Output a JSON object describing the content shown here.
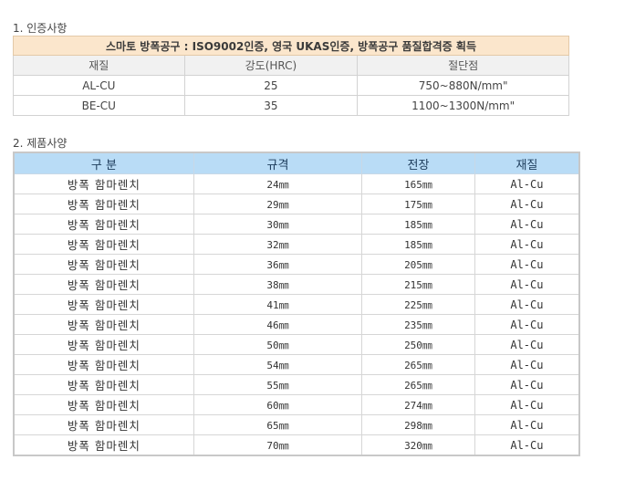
{
  "section1": {
    "title": "1. 인증사항",
    "banner": "스마토 방폭공구 : ISO9002인증, 영국 UKAS인증, 방폭공구 품질합격증 획득",
    "headers": [
      "재질",
      "강도(HRC)",
      "절단점"
    ],
    "rows": [
      [
        "AL-CU",
        "25",
        "750~880N/mm\""
      ],
      [
        "BE-CU",
        "35",
        "1100~1300N/mm\""
      ]
    ]
  },
  "section2": {
    "title": "2. 제품사양",
    "headers": [
      "구  분",
      "규격",
      "전장",
      "재질"
    ],
    "rows": [
      [
        "방폭 함마렌치",
        "24㎜",
        "165㎜",
        "Al-Cu"
      ],
      [
        "방폭 함마렌치",
        "29㎜",
        "175㎜",
        "Al-Cu"
      ],
      [
        "방폭 함마렌치",
        "30㎜",
        "185㎜",
        "Al-Cu"
      ],
      [
        "방폭 함마렌치",
        "32㎜",
        "185㎜",
        "Al-Cu"
      ],
      [
        "방폭 함마렌치",
        "36㎜",
        "205㎜",
        "Al-Cu"
      ],
      [
        "방폭 함마렌치",
        "38㎜",
        "215㎜",
        "Al-Cu"
      ],
      [
        "방폭 함마렌치",
        "41㎜",
        "225㎜",
        "Al-Cu"
      ],
      [
        "방폭 함마렌치",
        "46㎜",
        "235㎜",
        "Al-Cu"
      ],
      [
        "방폭 함마렌치",
        "50㎜",
        "250㎜",
        "Al-Cu"
      ],
      [
        "방폭 함마렌치",
        "54㎜",
        "265㎜",
        "Al-Cu"
      ],
      [
        "방폭 함마렌치",
        "55㎜",
        "265㎜",
        "Al-Cu"
      ],
      [
        "방폭 함마렌치",
        "60㎜",
        "274㎜",
        "Al-Cu"
      ],
      [
        "방폭 함마렌치",
        "65㎜",
        "298㎜",
        "Al-Cu"
      ],
      [
        "방폭 함마렌치",
        "70㎜",
        "320㎜",
        "Al-Cu"
      ]
    ]
  }
}
